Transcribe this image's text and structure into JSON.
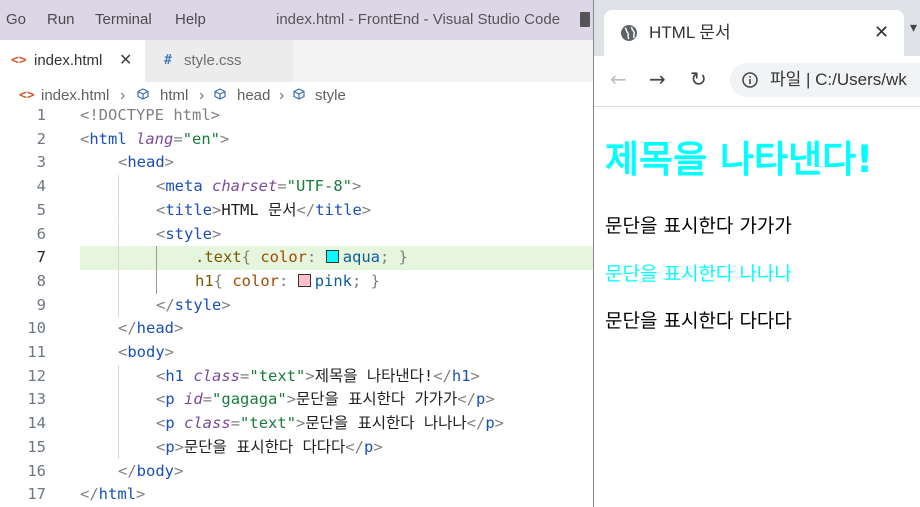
{
  "vscode": {
    "menu": [
      "Go",
      "Run",
      "Terminal",
      "Help"
    ],
    "window_title": "index.html - FrontEnd - Visual Studio Code",
    "tabs": [
      {
        "label": "index.html",
        "icon": "<>",
        "active": true
      },
      {
        "label": "style.css",
        "icon": "#",
        "active": false
      }
    ],
    "breadcrumb": [
      "index.html",
      "html",
      "head",
      "style"
    ],
    "line_numbers": [
      "1",
      "2",
      "3",
      "4",
      "5",
      "6",
      "7",
      "8",
      "9",
      "10",
      "11",
      "12",
      "13",
      "14",
      "15",
      "16",
      "17"
    ],
    "code": {
      "l1": {
        "t1": "<!DOCTYPE html>"
      },
      "l2": {
        "t1": "<",
        "t2": "html",
        "t3": " lang",
        "t4": "=",
        "t5": "\"en\"",
        "t6": ">"
      },
      "l3": {
        "t1": "<",
        "t2": "head",
        "t3": ">"
      },
      "l4": {
        "t1": "<",
        "t2": "meta",
        "t3": " charset",
        "t4": "=",
        "t5": "\"UTF-8\"",
        "t6": ">"
      },
      "l5": {
        "t1": "<",
        "t2": "title",
        "t3": ">",
        "t4": "HTML 문서",
        "t5": "</",
        "t6": "title",
        "t7": ">"
      },
      "l6": {
        "t1": "<",
        "t2": "style",
        "t3": ">"
      },
      "l7": {
        "t1": ".text",
        "t2": "{ ",
        "t3": "color",
        "t4": ": ",
        "t5": "aqua",
        "t6": "; }"
      },
      "l8": {
        "t1": "h1",
        "t2": "{ ",
        "t3": "color",
        "t4": ": ",
        "t5": "pink",
        "t6": "; }"
      },
      "l9": {
        "t1": "</",
        "t2": "style",
        "t3": ">"
      },
      "l10": {
        "t1": "</",
        "t2": "head",
        "t3": ">"
      },
      "l11": {
        "t1": "<",
        "t2": "body",
        "t3": ">"
      },
      "l12": {
        "t1": "<",
        "t2": "h1",
        "t3": " class",
        "t4": "=",
        "t5": "\"text\"",
        "t6": ">",
        "t7": "제목을 나타낸다!",
        "t8": "</",
        "t9": "h1",
        "t10": ">"
      },
      "l13": {
        "t1": "<",
        "t2": "p",
        "t3": " id",
        "t4": "=",
        "t5": "\"gagaga\"",
        "t6": ">",
        "t7": "문단을 표시한다 가가가",
        "t8": "</",
        "t9": "p",
        "t10": ">"
      },
      "l14": {
        "t1": "<",
        "t2": "p",
        "t3": " class",
        "t4": "=",
        "t5": "\"text\"",
        "t6": ">",
        "t7": "문단을 표시한다 나나나",
        "t8": "</",
        "t9": "p",
        "t10": ">"
      },
      "l15": {
        "t1": "<",
        "t2": "p",
        "t3": ">",
        "t4": "문단을 표시한다 다다다",
        "t5": "</",
        "t6": "p",
        "t7": ">"
      },
      "l16": {
        "t1": "</",
        "t2": "body",
        "t3": ">"
      },
      "l17": {
        "t1": "</",
        "t2": "html",
        "t3": ">"
      }
    },
    "swatch_colors": {
      "aqua": "#00ffff",
      "pink": "#ffc0cb"
    },
    "highlighted_line": 7
  },
  "browser": {
    "tab_title": "HTML 문서",
    "tab_close": "✕",
    "address": "파일  |  C:/Users/wk",
    "content": {
      "h1": "제목을 나타낸다!",
      "p1": "문단을 표시한다 가가가",
      "p2": "문단을 표시한다 나나나",
      "p3": "문단을 표시한다 다다다"
    },
    "colors": {
      "h1": "aqua",
      "p2": "aqua"
    }
  }
}
